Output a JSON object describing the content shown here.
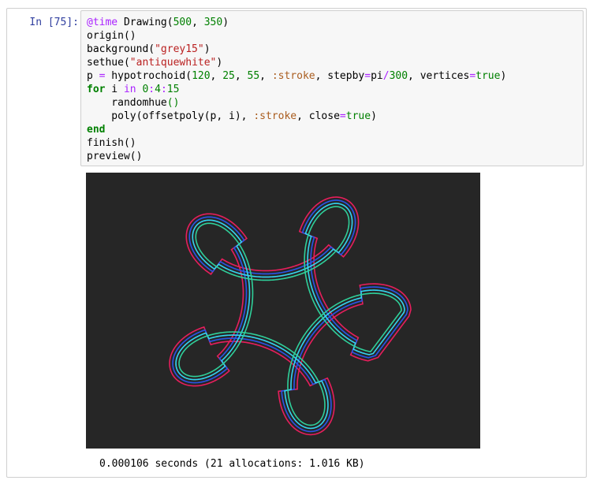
{
  "cell": {
    "prompt": "In [75]:",
    "code_lines": [
      [
        {
          "t": "@time",
          "c": "macro"
        },
        {
          "t": " Drawing(",
          "c": ""
        },
        {
          "t": "500",
          "c": "num"
        },
        {
          "t": ", ",
          "c": ""
        },
        {
          "t": "350",
          "c": "num"
        },
        {
          "t": ")",
          "c": ""
        }
      ],
      [
        {
          "t": "origin()",
          "c": ""
        }
      ],
      [
        {
          "t": "background(",
          "c": ""
        },
        {
          "t": "\"grey15\"",
          "c": "string"
        },
        {
          "t": ")",
          "c": ""
        }
      ],
      [
        {
          "t": "sethue(",
          "c": ""
        },
        {
          "t": "\"antiquewhite\"",
          "c": "string"
        },
        {
          "t": ")",
          "c": ""
        }
      ],
      [
        {
          "t": "p ",
          "c": ""
        },
        {
          "t": "=",
          "c": "op"
        },
        {
          "t": " hypotrochoid(",
          "c": ""
        },
        {
          "t": "120",
          "c": "num"
        },
        {
          "t": ", ",
          "c": ""
        },
        {
          "t": "25",
          "c": "num"
        },
        {
          "t": ", ",
          "c": ""
        },
        {
          "t": "55",
          "c": "num"
        },
        {
          "t": ", ",
          "c": ""
        },
        {
          "t": ":stroke",
          "c": "symbol"
        },
        {
          "t": ", stepby",
          "c": ""
        },
        {
          "t": "=",
          "c": "op"
        },
        {
          "t": "pi",
          "c": ""
        },
        {
          "t": "/",
          "c": "op"
        },
        {
          "t": "300",
          "c": "num"
        },
        {
          "t": ", vertices",
          "c": ""
        },
        {
          "t": "=",
          "c": "op"
        },
        {
          "t": "true",
          "c": "bool"
        },
        {
          "t": ")",
          "c": ""
        }
      ],
      [
        {
          "t": "for",
          "c": "kw"
        },
        {
          "t": " i ",
          "c": ""
        },
        {
          "t": "in",
          "c": "op"
        },
        {
          "t": " ",
          "c": ""
        },
        {
          "t": "0",
          "c": "num"
        },
        {
          "t": ":",
          "c": "op"
        },
        {
          "t": "4",
          "c": "num"
        },
        {
          "t": ":",
          "c": "op"
        },
        {
          "t": "15",
          "c": "num"
        }
      ],
      [
        {
          "t": "    randomhue",
          "c": ""
        },
        {
          "t": "()",
          "c": "paren"
        }
      ],
      [
        {
          "t": "    poly(offsetpoly(p, i), ",
          "c": ""
        },
        {
          "t": ":stroke",
          "c": "symbol"
        },
        {
          "t": ", close",
          "c": ""
        },
        {
          "t": "=",
          "c": "op"
        },
        {
          "t": "true",
          "c": "bool"
        },
        {
          "t": ")",
          "c": ""
        }
      ],
      [
        {
          "t": "end",
          "c": "kw"
        }
      ],
      [
        {
          "t": "finish()",
          "c": ""
        }
      ],
      [
        {
          "t": "preview()",
          "c": ""
        }
      ]
    ],
    "output_text": "0.000106 seconds (21 allocations: 1.016 KB)"
  },
  "drawing": {
    "background_color": "#262626",
    "hypotrochoid": {
      "R": 120,
      "r": 25,
      "d": 55
    },
    "offsets": [
      0,
      4,
      8,
      12
    ],
    "stroke_colors": [
      "#2fd09a",
      "#35d4f0",
      "#2a55e8",
      "#e81e5c"
    ]
  }
}
